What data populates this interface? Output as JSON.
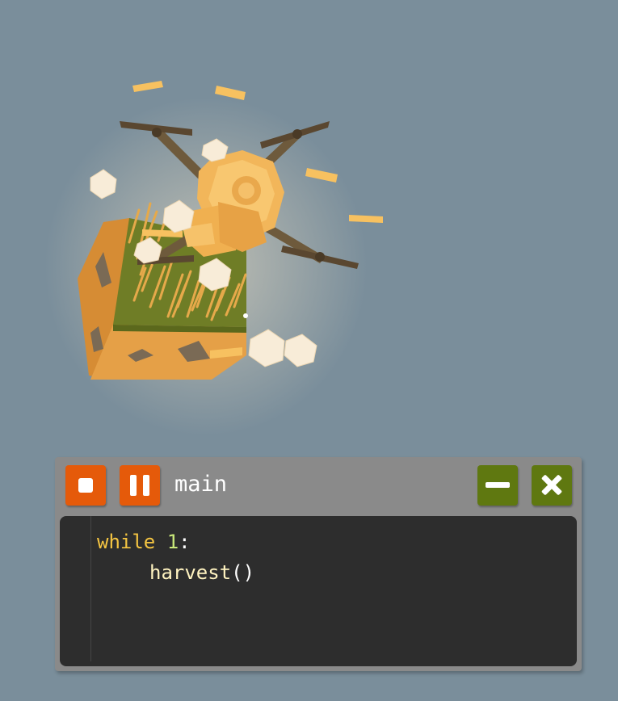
{
  "code_window": {
    "title": "main",
    "controls": {
      "stop_icon": "stop-icon",
      "pause_icon": "pause-icon",
      "minimize_icon": "minus-icon",
      "close_icon": "close-icon"
    },
    "code": {
      "line1": {
        "keyword": "while",
        "number": "1",
        "punct": ":"
      },
      "line2": {
        "call": "harvest",
        "parens": "()"
      }
    }
  },
  "colors": {
    "background": "#7a8e9b",
    "stop_pause_buttons": "#e55a0a",
    "window_buttons": "#5f7810",
    "editor_bg": "#2d2d2d",
    "keyword": "#f5c542",
    "number": "#c9e87a"
  }
}
